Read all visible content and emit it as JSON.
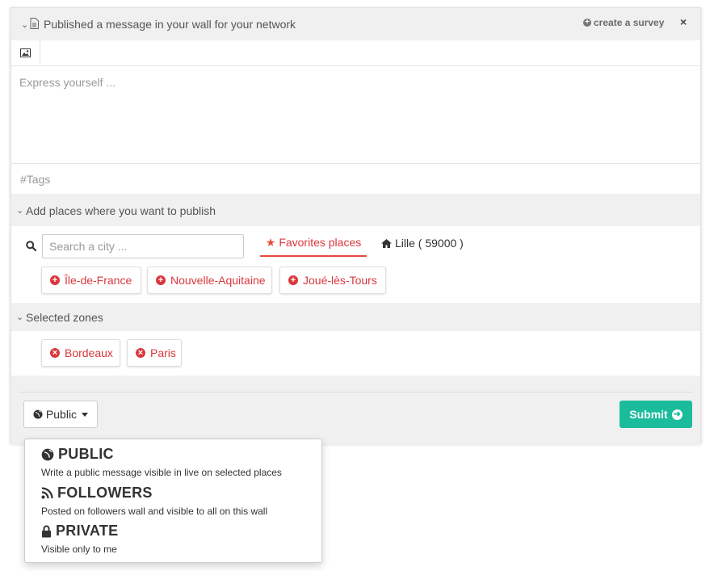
{
  "header": {
    "title": "Published a message in your wall for your network",
    "create_survey": "create a survey",
    "close": "×"
  },
  "editor": {
    "message_placeholder": "Express yourself ...",
    "tags_placeholder": "#Tags"
  },
  "places": {
    "section_label": "Add places where you want to publish",
    "search_placeholder": "Search a city ...",
    "tab_favorites": "Favorites places",
    "tab_home": "Lille ( 59000 )",
    "favorites": [
      "Île-de-France",
      "Nouvelle-Aquitaine",
      "Joué-lès-Tours"
    ]
  },
  "zones": {
    "section_label": "Selected zones",
    "selected": [
      "Bordeaux",
      "Paris"
    ]
  },
  "footer": {
    "visibility_label": "Public",
    "submit_label": "Submit"
  },
  "visibility_menu": [
    {
      "title": "PUBLIC",
      "desc": "Write a public message visible in live on selected places",
      "icon": "globe-icon"
    },
    {
      "title": "FOLLOWERS",
      "desc": "Posted on followers wall and visible to all on this wall",
      "icon": "rss-icon"
    },
    {
      "title": "PRIVATE",
      "desc": "Visible only to me",
      "icon": "lock-icon"
    }
  ],
  "colors": {
    "accent_red": "#d9383d",
    "submit_green": "#1abc9c",
    "panel_bg": "#f0f0f0"
  }
}
